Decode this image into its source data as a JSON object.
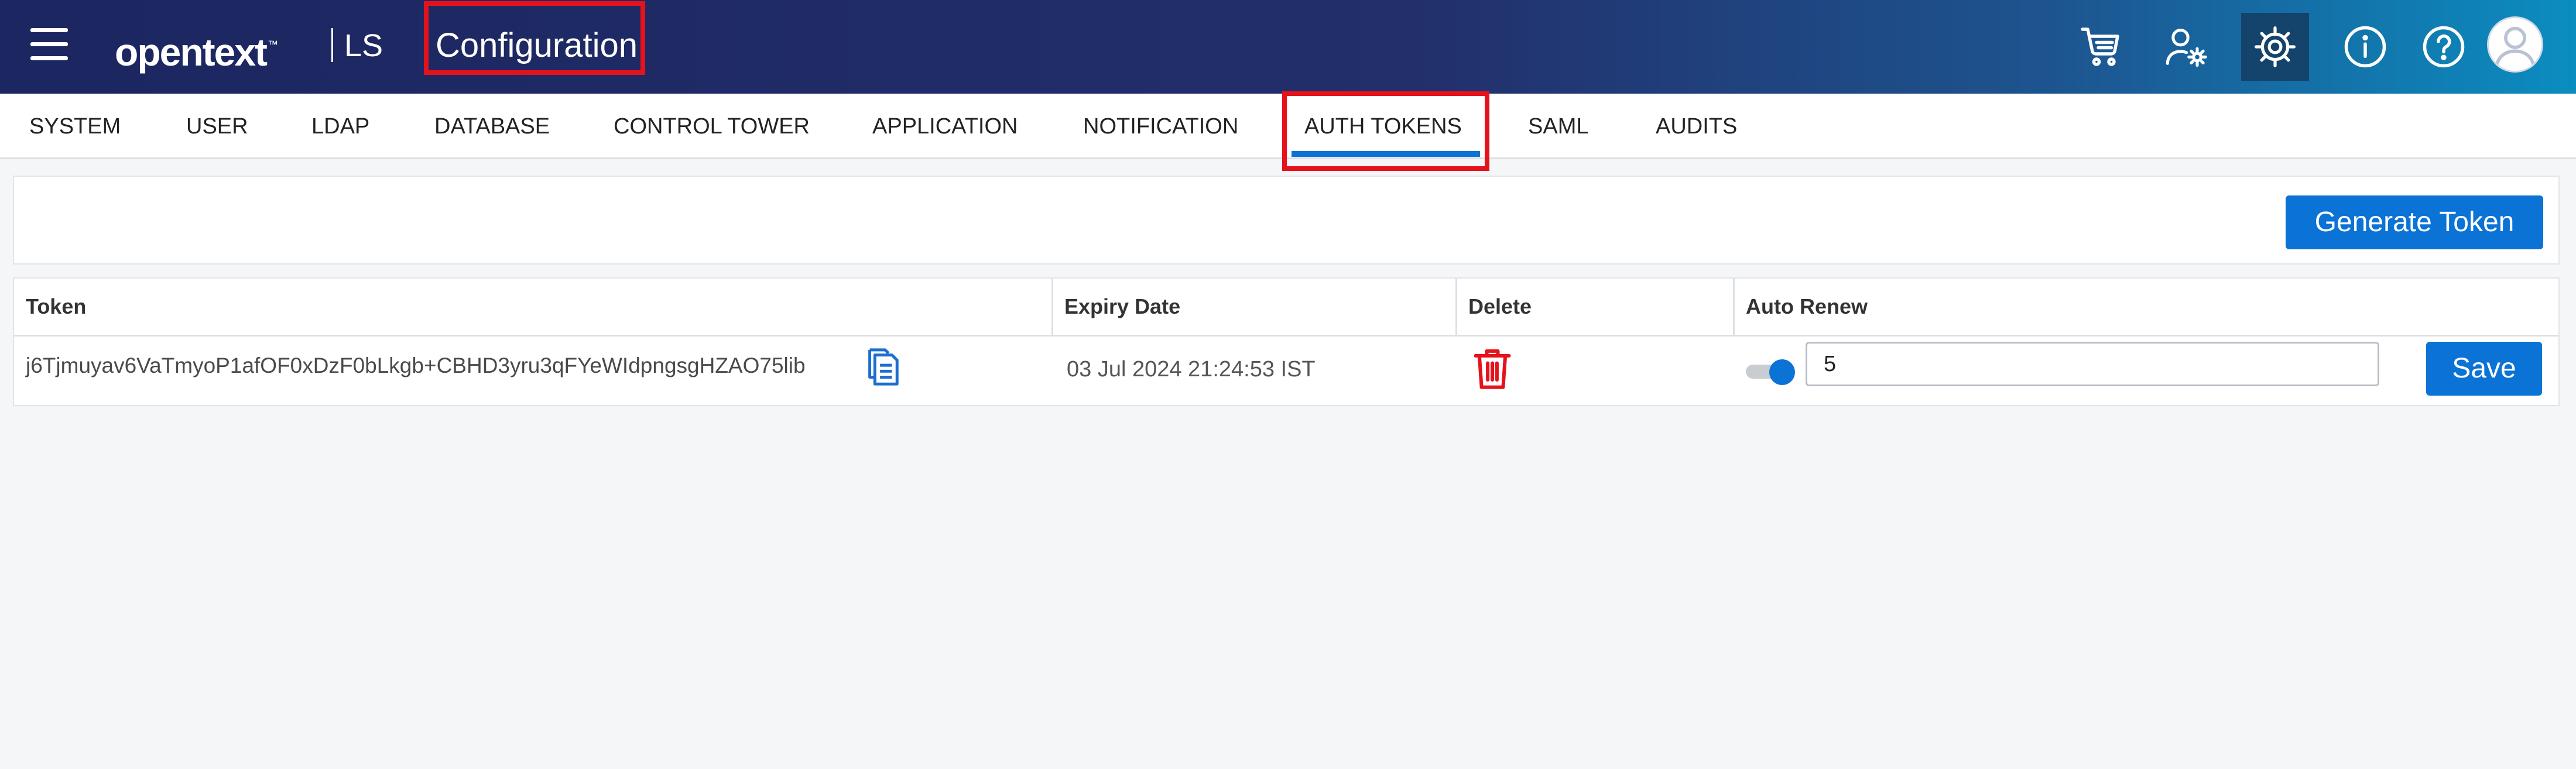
{
  "header": {
    "brand": "opentext",
    "brand_tm": "™",
    "product": "LS",
    "page_title": "Configuration",
    "icons": [
      "cart-icon",
      "user-settings-icon",
      "gear-icon",
      "info-icon",
      "help-icon",
      "avatar-icon"
    ],
    "colors": {
      "gradient_start": "#1c2660",
      "gradient_end": "#0b8dc0",
      "active_icon_bg": "#14436b",
      "highlight": "#e5121c"
    }
  },
  "tabs": [
    {
      "label": "SYSTEM"
    },
    {
      "label": "USER"
    },
    {
      "label": "LDAP"
    },
    {
      "label": "DATABASE"
    },
    {
      "label": "CONTROL TOWER"
    },
    {
      "label": "APPLICATION"
    },
    {
      "label": "NOTIFICATION"
    },
    {
      "label": "AUTH TOKENS",
      "active": true
    },
    {
      "label": "SAML"
    },
    {
      "label": "AUDITS"
    }
  ],
  "toolbar": {
    "generate_label": "Generate Token"
  },
  "table": {
    "columns": [
      "Token",
      "Expiry Date",
      "Delete",
      "Auto Renew"
    ],
    "rows": [
      {
        "token": "j6Tjmuyav6VaTmyoP1afOF0xDzF0bLkgb+CBHD3yru3qFYeWIdpngsgHZAO75lib",
        "expiry": "03 Jul 2024 21:24:53 IST",
        "auto_renew": true,
        "renew_value": "5"
      }
    ],
    "save_label": "Save"
  },
  "accent_color": "#0b72d6",
  "danger_color": "#e5121c"
}
